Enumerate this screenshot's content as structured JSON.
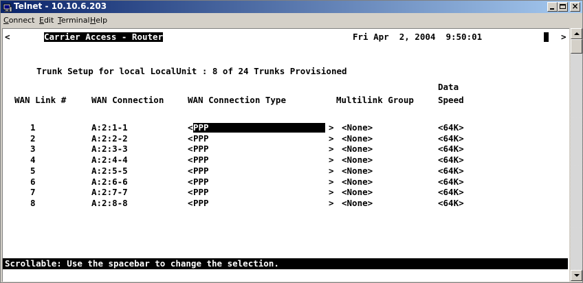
{
  "window": {
    "title": "Telnet - 10.10.6.203"
  },
  "menu": {
    "items": [
      "Connect",
      "Edit",
      "Terminal",
      "Help"
    ]
  },
  "terminal": {
    "left_marker": "<",
    "right_marker": ">",
    "app_name": "Carrier Access - Router",
    "datetime": "Fri Apr  2, 2004  9:50:01",
    "subtitle": "Trunk Setup for local LocalUnit : 8 of 24 Trunks Provisioned",
    "headers": {
      "wan_link": "WAN Link #",
      "wan_connection": "WAN Connection",
      "wan_connection_type": "WAN Connection Type",
      "multilink_group": "Multilink Group",
      "data_speed_line1": "Data",
      "data_speed_line2": "Speed"
    },
    "rows": [
      {
        "link": "1",
        "connection": "A:2:1-1",
        "type": "PPP",
        "multilink": "<None>",
        "speed": "<64K>"
      },
      {
        "link": "2",
        "connection": "A:2:2-2",
        "type": "PPP",
        "multilink": "<None>",
        "speed": "<64K>"
      },
      {
        "link": "3",
        "connection": "A:2:3-3",
        "type": "PPP",
        "multilink": "<None>",
        "speed": "<64K>"
      },
      {
        "link": "4",
        "connection": "A:2:4-4",
        "type": "PPP",
        "multilink": "<None>",
        "speed": "<64K>"
      },
      {
        "link": "5",
        "connection": "A:2:5-5",
        "type": "PPP",
        "multilink": "<None>",
        "speed": "<64K>"
      },
      {
        "link": "6",
        "connection": "A:2:6-6",
        "type": "PPP",
        "multilink": "<None>",
        "speed": "<64K>"
      },
      {
        "link": "7",
        "connection": "A:2:7-7",
        "type": "PPP",
        "multilink": "<None>",
        "speed": "<64K>"
      },
      {
        "link": "8",
        "connection": "A:2:8-8",
        "type": "PPP",
        "multilink": "<None>",
        "speed": "<64K>"
      }
    ],
    "selected_row": 0,
    "status_line": "Scrollable: Use the spacebar to change the selection."
  },
  "colors": {
    "titlebar_start": "#0a246a",
    "titlebar_end": "#a6caf0",
    "terminal_bg": "#ffffff",
    "terminal_fg": "#000000",
    "chrome": "#d4d0c8"
  },
  "icons": {
    "window_icon": "telnet-window-icon",
    "minimize": "minimize-icon",
    "maximize": "maximize-icon",
    "close": "close-icon",
    "scroll_up": "scroll-up-arrow-icon",
    "scroll_down": "scroll-down-arrow-icon"
  }
}
